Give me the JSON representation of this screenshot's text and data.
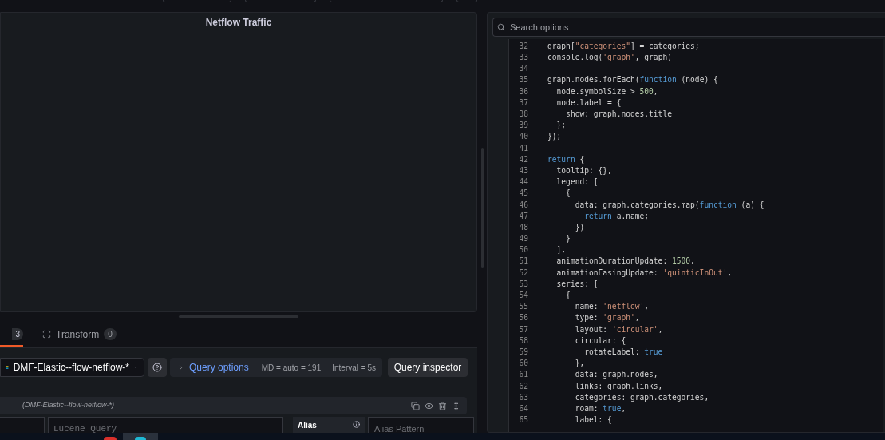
{
  "panel": {
    "title": "Netflow Traffic"
  },
  "tabs": [
    {
      "kind": "cut",
      "label": "3",
      "selected": true
    },
    {
      "kind": "full",
      "label": "Transform",
      "count": "0",
      "selected": false
    }
  ],
  "query_bar": {
    "datasource": "DMF-Elastic--flow-netflow-*",
    "options_label": "Query options",
    "md": "MD = auto = 191",
    "interval": "Interval = 5s",
    "inspector": "Query inspector"
  },
  "query_row": {
    "datasource": "(DMF-Elastic--flow-netflow-*)",
    "query_placeholder": "Lucene Query",
    "alias_label": "Alias",
    "alias_placeholder": "Alias Pattern"
  },
  "options": {
    "search_placeholder": "Search options"
  },
  "code_lines": [
    {
      "number": "32",
      "tokens": [
        {
          "kind": "plain",
          "text": "graph["
        },
        {
          "kind": "string",
          "text": "\"categories\""
        },
        {
          "kind": "plain",
          "text": "] = categories;"
        }
      ]
    },
    {
      "number": "33",
      "tokens": [
        {
          "kind": "plain",
          "text": "console.log("
        },
        {
          "kind": "string",
          "text": "'graph'"
        },
        {
          "kind": "plain",
          "text": ", graph)"
        }
      ]
    },
    {
      "number": "34"
    },
    {
      "number": "35",
      "tokens": [
        {
          "kind": "plain",
          "text": "graph.nodes.forEach("
        },
        {
          "kind": "keyword",
          "text": "function"
        },
        {
          "kind": "plain",
          "text": " (node) {"
        }
      ]
    },
    {
      "number": "36",
      "tokens": [
        {
          "kind": "plain",
          "text": "  node.symbolSize > "
        },
        {
          "kind": "number",
          "text": "500"
        },
        {
          "kind": "plain",
          "text": ","
        }
      ]
    },
    {
      "number": "37",
      "tokens": [
        {
          "kind": "plain",
          "text": "  node.label = {"
        }
      ]
    },
    {
      "number": "38",
      "tokens": [
        {
          "kind": "plain",
          "text": "    show: graph.nodes.title"
        }
      ]
    },
    {
      "number": "39",
      "tokens": [
        {
          "kind": "plain",
          "text": "  };"
        }
      ]
    },
    {
      "number": "40",
      "tokens": [
        {
          "kind": "plain",
          "text": "});"
        }
      ]
    },
    {
      "number": "41"
    },
    {
      "number": "42",
      "tokens": [
        {
          "kind": "keyword",
          "text": "return"
        },
        {
          "kind": "plain",
          "text": " {"
        }
      ]
    },
    {
      "number": "43",
      "tokens": [
        {
          "kind": "plain",
          "text": "  tooltip: {},"
        }
      ]
    },
    {
      "number": "44",
      "tokens": [
        {
          "kind": "plain",
          "text": "  legend: ["
        }
      ]
    },
    {
      "number": "45",
      "tokens": [
        {
          "kind": "plain",
          "text": "    {"
        }
      ]
    },
    {
      "number": "46",
      "tokens": [
        {
          "kind": "plain",
          "text": "      data: graph.categories.map("
        },
        {
          "kind": "keyword",
          "text": "function"
        },
        {
          "kind": "plain",
          "text": " (a) {"
        }
      ]
    },
    {
      "number": "47",
      "tokens": [
        {
          "kind": "keyword",
          "text": "        return"
        },
        {
          "kind": "plain",
          "text": " a.name;"
        }
      ]
    },
    {
      "number": "48",
      "tokens": [
        {
          "kind": "plain",
          "text": "      })"
        }
      ]
    },
    {
      "number": "49",
      "tokens": [
        {
          "kind": "plain",
          "text": "    }"
        }
      ]
    },
    {
      "number": "50",
      "tokens": [
        {
          "kind": "plain",
          "text": "  ],"
        }
      ]
    },
    {
      "number": "51",
      "tokens": [
        {
          "kind": "plain",
          "text": "  animationDurationUpdate: "
        },
        {
          "kind": "number",
          "text": "1500"
        },
        {
          "kind": "plain",
          "text": ","
        }
      ]
    },
    {
      "number": "52",
      "tokens": [
        {
          "kind": "plain",
          "text": "  animationEasingUpdate: "
        },
        {
          "kind": "string",
          "text": "'quinticInOut'"
        },
        {
          "kind": "plain",
          "text": ","
        }
      ]
    },
    {
      "number": "53",
      "tokens": [
        {
          "kind": "plain",
          "text": "  series: ["
        }
      ]
    },
    {
      "number": "54",
      "tokens": [
        {
          "kind": "plain",
          "text": "    {"
        }
      ]
    },
    {
      "number": "55",
      "tokens": [
        {
          "kind": "plain",
          "text": "      name: "
        },
        {
          "kind": "string",
          "text": "'netflow'"
        },
        {
          "kind": "plain",
          "text": ","
        }
      ]
    },
    {
      "number": "56",
      "tokens": [
        {
          "kind": "plain",
          "text": "      type: "
        },
        {
          "kind": "string",
          "text": "'graph'"
        },
        {
          "kind": "plain",
          "text": ","
        }
      ]
    },
    {
      "number": "57",
      "tokens": [
        {
          "kind": "plain",
          "text": "      layout: "
        },
        {
          "kind": "string",
          "text": "'circular'"
        },
        {
          "kind": "plain",
          "text": ","
        }
      ]
    },
    {
      "number": "58",
      "tokens": [
        {
          "kind": "plain",
          "text": "      circular: {"
        }
      ]
    },
    {
      "number": "59",
      "tokens": [
        {
          "kind": "plain",
          "text": "        rotateLabel: "
        },
        {
          "kind": "keyword",
          "text": "true"
        }
      ]
    },
    {
      "number": "60",
      "tokens": [
        {
          "kind": "plain",
          "text": "      },"
        }
      ]
    },
    {
      "number": "61",
      "tokens": [
        {
          "kind": "plain",
          "text": "      data: graph.nodes,"
        }
      ]
    },
    {
      "number": "62",
      "tokens": [
        {
          "kind": "plain",
          "text": "      links: graph.links,"
        }
      ]
    },
    {
      "number": "63",
      "tokens": [
        {
          "kind": "plain",
          "text": "      categories: graph.categories,"
        }
      ]
    },
    {
      "number": "64",
      "tokens": [
        {
          "kind": "plain",
          "text": "      roam: "
        },
        {
          "kind": "keyword",
          "text": "true"
        },
        {
          "kind": "plain",
          "text": ","
        }
      ]
    },
    {
      "number": "65",
      "tokens": [
        {
          "kind": "plain",
          "text": "      label: {"
        }
      ]
    }
  ]
}
